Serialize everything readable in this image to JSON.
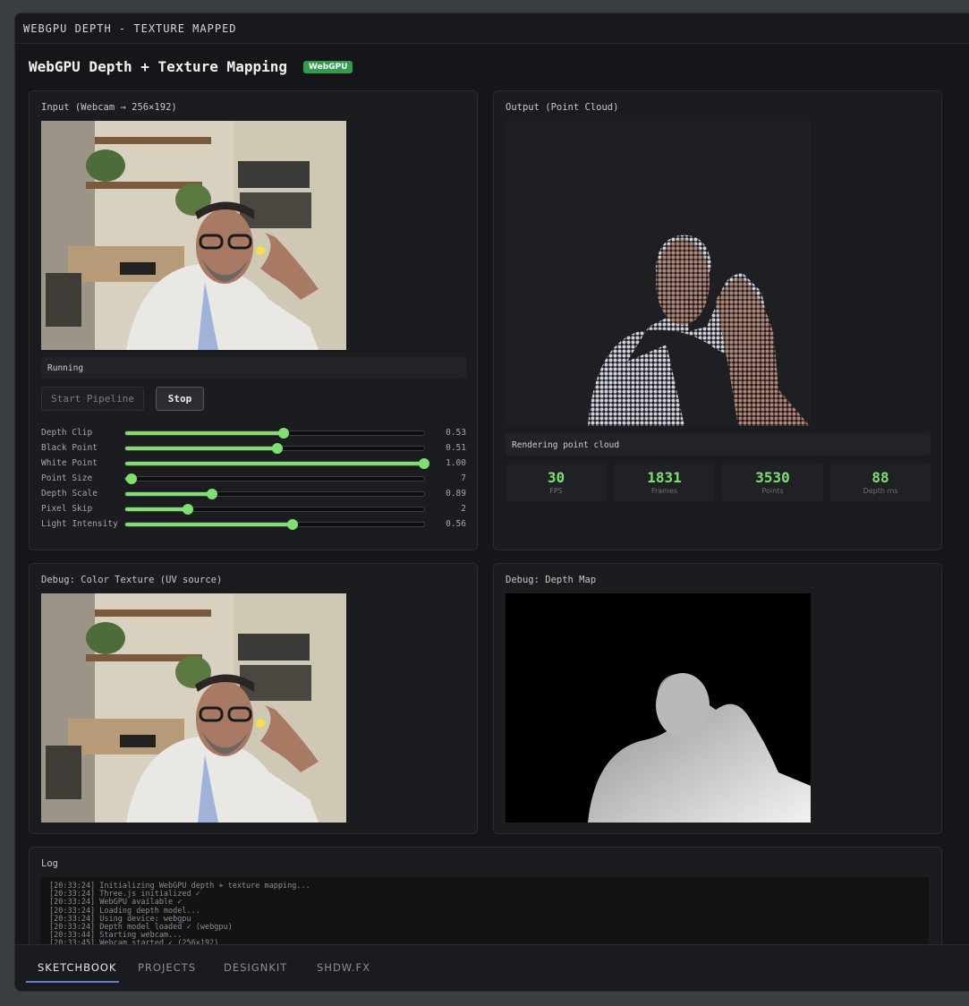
{
  "window_title": "WEBGPU DEPTH - TEXTURE MAPPED",
  "header": {
    "title": "WebGPU Depth + Texture Mapping",
    "badge": "WebGPU"
  },
  "input_panel": {
    "title": "Input (Webcam → 256×192)",
    "status": "Running",
    "start_label": "Start Pipeline",
    "stop_label": "Stop",
    "sliders": [
      {
        "label": "Depth Clip",
        "value": "0.53",
        "fraction": 0.53
      },
      {
        "label": "Black Point",
        "value": "0.51",
        "fraction": 0.51
      },
      {
        "label": "White Point",
        "value": "1.00",
        "fraction": 1.0
      },
      {
        "label": "Point Size",
        "value": "7",
        "fraction": 0.02
      },
      {
        "label": "Depth Scale",
        "value": "0.89",
        "fraction": 0.29
      },
      {
        "label": "Pixel Skip",
        "value": "2",
        "fraction": 0.21
      },
      {
        "label": "Light Intensity",
        "value": "0.56",
        "fraction": 0.56
      }
    ]
  },
  "output_panel": {
    "title": "Output (Point Cloud)",
    "status": "Rendering point cloud",
    "stats": [
      {
        "value": "30",
        "label": "FPS"
      },
      {
        "value": "1831",
        "label": "Frames"
      },
      {
        "value": "3530",
        "label": "Points"
      },
      {
        "value": "88",
        "label": "Depth ms"
      }
    ]
  },
  "debug_color": {
    "title": "Debug: Color Texture (UV source)"
  },
  "debug_depth": {
    "title": "Debug: Depth Map"
  },
  "log": {
    "title": "Log",
    "lines": [
      "[20:33:24] Initializing WebGPU depth + texture mapping...",
      "[20:33:24] Three.js initialized ✓",
      "[20:33:24] WebGPU available ✓",
      "[20:33:24] Loading depth model...",
      "[20:33:24] Using device: webgpu",
      "[20:33:24] Depth model loaded ✓ (webgpu)",
      "[20:33:44] Starting webcam...",
      "[20:33:45] Webcam started ✓ (256×192)"
    ]
  },
  "bottom_nav": {
    "items": [
      {
        "label": "SKETCHBOOK"
      },
      {
        "label": "PROJECTS"
      },
      {
        "label": "DESIGNKIT"
      },
      {
        "label": "SHDW.FX"
      }
    ]
  },
  "colors": {
    "accent": "#7ee06f",
    "badge": "#2f9e4c",
    "nav_underline": "#5a82c4"
  }
}
